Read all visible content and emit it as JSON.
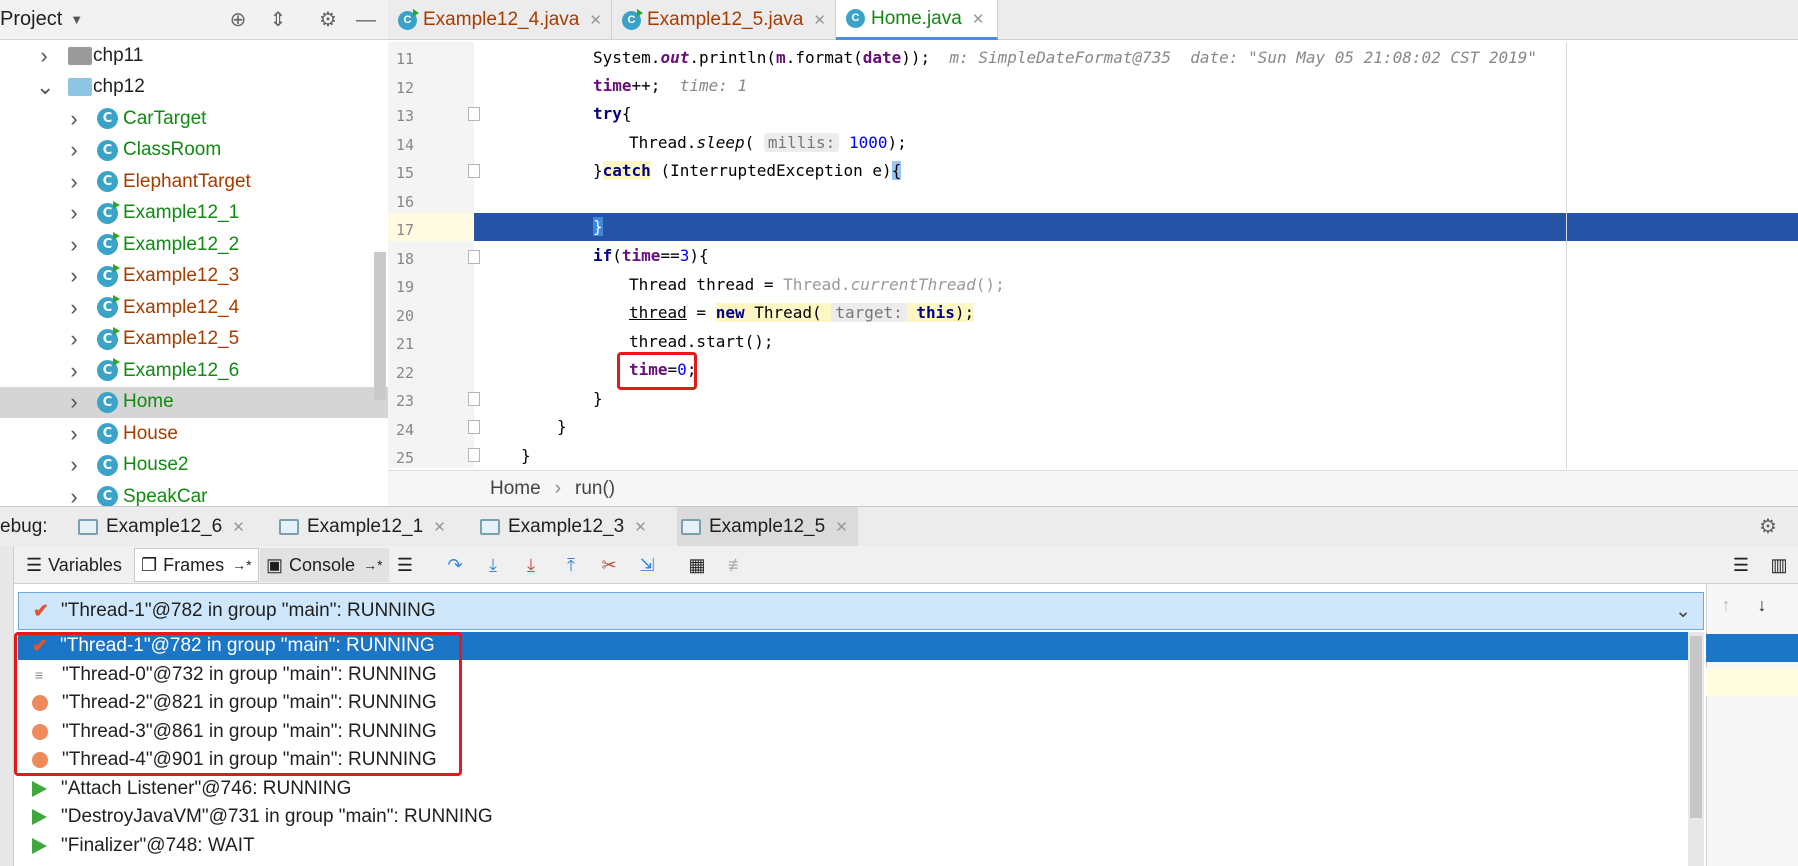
{
  "project": {
    "title": "Project"
  },
  "tree": [
    {
      "label": "chp11",
      "kind": "folder",
      "expanded": false,
      "color": "#000"
    },
    {
      "label": "chp12",
      "kind": "folder",
      "expanded": true,
      "color": "#000"
    },
    {
      "label": "CarTarget",
      "kind": "class",
      "color": "green"
    },
    {
      "label": "ClassRoom",
      "kind": "class",
      "color": "green"
    },
    {
      "label": "ElephantTarget",
      "kind": "class",
      "color": "brown"
    },
    {
      "label": "Example12_1",
      "kind": "runclass",
      "color": "green"
    },
    {
      "label": "Example12_2",
      "kind": "runclass",
      "color": "green"
    },
    {
      "label": "Example12_3",
      "kind": "runclass",
      "color": "brown"
    },
    {
      "label": "Example12_4",
      "kind": "runclass",
      "color": "brown"
    },
    {
      "label": "Example12_5",
      "kind": "runclass",
      "color": "brown"
    },
    {
      "label": "Example12_6",
      "kind": "runclass",
      "color": "green"
    },
    {
      "label": "Home",
      "kind": "class",
      "color": "green",
      "selected": true
    },
    {
      "label": "House",
      "kind": "class",
      "color": "brown"
    },
    {
      "label": "House2",
      "kind": "class",
      "color": "green"
    },
    {
      "label": "SpeakCar",
      "kind": "class",
      "color": "green"
    }
  ],
  "editor_tabs": [
    {
      "label": "Example12_4.java",
      "color": "brown",
      "run": true
    },
    {
      "label": "Example12_5.java",
      "color": "brown",
      "run": true
    },
    {
      "label": "Home.java",
      "color": "green",
      "run": false,
      "active": true
    }
  ],
  "line_numbers": [
    "11",
    "12",
    "13",
    "14",
    "15",
    "16",
    "17",
    "18",
    "19",
    "20",
    "21",
    "22",
    "23",
    "24",
    "25"
  ],
  "code": {
    "l11a": "System.",
    "l11b": "out",
    "l11c": ".println(",
    "l11d": "m",
    "l11e": ".format(",
    "l11f": "date",
    "l11g": "));",
    "l11hint": "m: SimpleDateFormat@735  date: \"Sun May 05 21:08:02 CST 2019\"",
    "l12a": "time",
    "l12b": "++;",
    "l12hint": "time: 1",
    "l13a": "try",
    "l13b": "{",
    "l14a": "Thread.",
    "l14b": "sleep",
    "l14c": "( ",
    "l14d": "millis:",
    "l14e": " 1000",
    "l14f": ");",
    "l15a": "}",
    "l15b": "catch",
    "l15c": " (InterruptedException e)",
    "l15d": "{",
    "l17a": "}",
    "l18a": "if",
    "l18b": "(",
    "l18c": "time",
    "l18d": "==",
    "l18e": "3",
    "l18f": "){",
    "l19a": "Thread thread = ",
    "l19b": "Thread.",
    "l19c": "currentThread",
    "l19d": "();",
    "l20a": "thread",
    "l20b": " = ",
    "l20c": "new",
    "l20d": " Thread( ",
    "l20e": "target:",
    "l20f": " this",
    "l20g": ");",
    "l21a": "thread.start();",
    "l22a": "time",
    "l22b": "=",
    "l22c": "0",
    "l22d": ";",
    "l23a": "}",
    "l24a": "}",
    "l25a": "}"
  },
  "breadcrumb": {
    "a": "Home",
    "sep": "›",
    "b": "run()"
  },
  "debug": {
    "label": "ebug:",
    "tabs": [
      {
        "label": "Example12_6",
        "active": false
      },
      {
        "label": "Example12_1",
        "active": false
      },
      {
        "label": "Example12_3",
        "active": false
      },
      {
        "label": "Example12_5",
        "active": true
      }
    ],
    "toolbar": {
      "variables": "Variables",
      "frames": "Frames",
      "frames_pin": "→*",
      "console": "Console",
      "console_pin": "→*"
    }
  },
  "thread_combo": "\"Thread-1\"@782 in group \"main\": RUNNING",
  "threads": [
    {
      "label": "\"Thread-1\"@782 in group \"main\": RUNNING",
      "icon": "check",
      "selected": true
    },
    {
      "label": "\"Thread-0\"@732 in group \"main\": RUNNING",
      "icon": "lines"
    },
    {
      "label": "\"Thread-2\"@821 in group \"main\": RUNNING",
      "icon": "dot"
    },
    {
      "label": "\"Thread-3\"@861 in group \"main\": RUNNING",
      "icon": "dot"
    },
    {
      "label": "\"Thread-4\"@901 in group \"main\": RUNNING",
      "icon": "dot"
    },
    {
      "label": "\"Attach Listener\"@746: RUNNING",
      "icon": "play"
    },
    {
      "label": "\"DestroyJavaVM\"@731 in group \"main\": RUNNING",
      "icon": "play"
    },
    {
      "label": "\"Finalizer\"@748: WAIT",
      "icon": "play"
    }
  ],
  "colors": {
    "accent": "#2553a5",
    "selection": "#1c76c7",
    "highlight_red": "#e3191b",
    "green_text": "#108a10",
    "brown_text": "#a63c00"
  }
}
